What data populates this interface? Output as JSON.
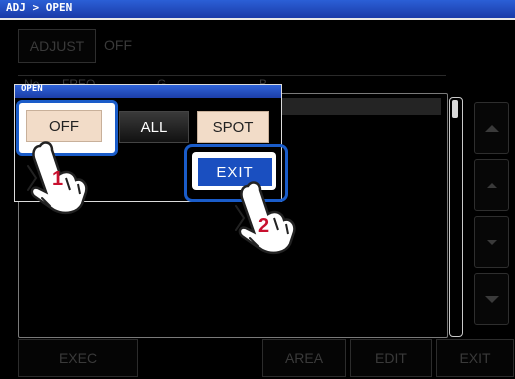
{
  "header": {
    "breadcrumb": "ADJ > OPEN"
  },
  "adjust": {
    "label": "ADJUST",
    "value": "OFF"
  },
  "table_header": {
    "col_no": "No.",
    "col_freq": "FREQ",
    "col_g": "G",
    "col_b": "B"
  },
  "popup": {
    "title": "OPEN",
    "buttons": [
      {
        "label": "OFF",
        "state": "selected"
      },
      {
        "label": "ALL",
        "state": "normal"
      },
      {
        "label": "SPOT",
        "state": "normal"
      }
    ],
    "exit_label": "EXIT"
  },
  "steps": {
    "step1": "1",
    "step2": "2"
  },
  "footer": {
    "exec": "EXEC",
    "area": "AREA",
    "edit": "EDIT",
    "exit": "EXIT"
  },
  "colors": {
    "title_bar": "#1a3aa8",
    "highlight": "#1a5cc9",
    "exit_button": "#1a4fc0",
    "off_button": "#f2dcc8",
    "step_number": "#c8102e"
  },
  "icons": {
    "scroll_up": "triangle-up-icon",
    "scroll_down": "triangle-down-icon",
    "hand": "pointing-hand-icon"
  }
}
